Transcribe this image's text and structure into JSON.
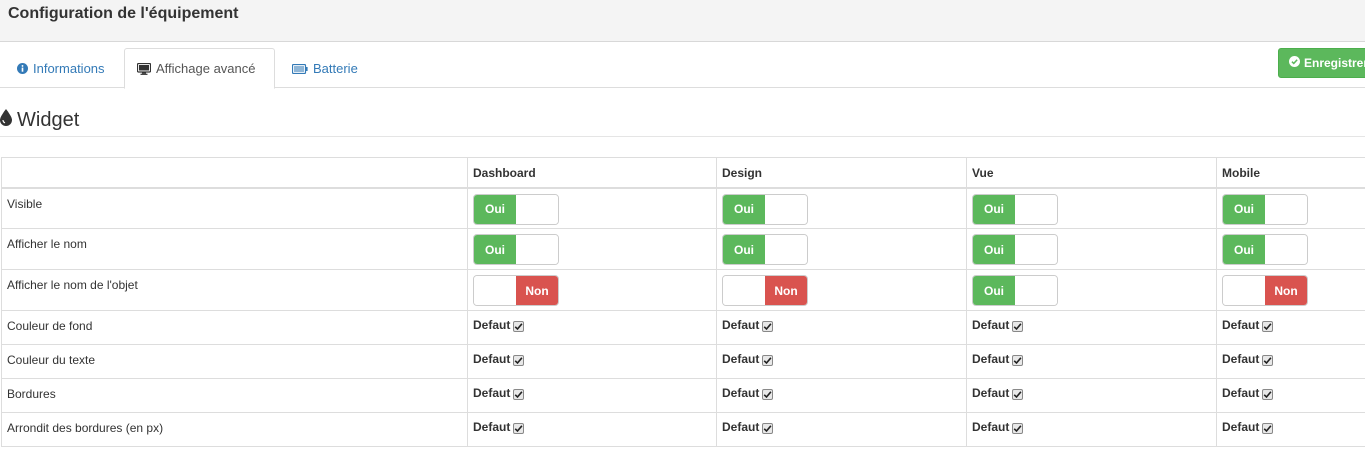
{
  "header": {
    "title": "Configuration de l'équipement"
  },
  "tabs": [
    {
      "label": "Informations",
      "icon": "info-circle-icon",
      "active": false
    },
    {
      "label": "Affichage avancé",
      "icon": "monitor-icon",
      "active": true
    },
    {
      "label": "Batterie",
      "icon": "battery-icon",
      "active": false
    }
  ],
  "actions": {
    "save_label": "Enregistrer",
    "save_icon": "check-circle-icon"
  },
  "widget": {
    "title": "Widget",
    "icon": "tint-icon",
    "columns": [
      "",
      "Dashboard",
      "Design",
      "Vue",
      "Mobile"
    ],
    "toggle_rows": [
      {
        "label": "Visible",
        "values": [
          "Oui",
          "Oui",
          "Oui",
          "Oui"
        ]
      },
      {
        "label": "Afficher le nom",
        "values": [
          "Oui",
          "Oui",
          "Oui",
          "Oui"
        ]
      },
      {
        "label": "Afficher le nom de l'objet",
        "values": [
          "Non",
          "Non",
          "Oui",
          "Non"
        ]
      }
    ],
    "check_rows": [
      {
        "label": "Couleur de fond",
        "values": [
          "Defaut",
          "Defaut",
          "Defaut",
          "Defaut"
        ],
        "checked": [
          true,
          true,
          true,
          true
        ]
      },
      {
        "label": "Couleur du texte",
        "values": [
          "Defaut",
          "Defaut",
          "Defaut",
          "Defaut"
        ],
        "checked": [
          true,
          true,
          true,
          true
        ]
      },
      {
        "label": "Bordures",
        "values": [
          "Defaut",
          "Defaut",
          "Defaut",
          "Defaut"
        ],
        "checked": [
          true,
          true,
          true,
          true
        ]
      },
      {
        "label": "Arrondit des bordures (en px)",
        "values": [
          "Defaut",
          "Defaut",
          "Defaut",
          "Defaut"
        ],
        "checked": [
          true,
          true,
          true,
          true
        ]
      }
    ]
  },
  "colors": {
    "on": "#5cb85c",
    "off": "#d9534f",
    "link": "#337ab7"
  }
}
